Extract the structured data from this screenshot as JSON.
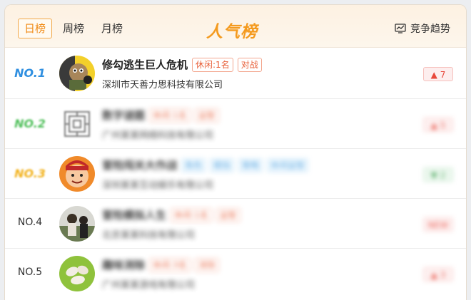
{
  "header": {
    "tabs": [
      {
        "label": "日榜",
        "active": true
      },
      {
        "label": "周榜",
        "active": false
      },
      {
        "label": "月榜",
        "active": false
      }
    ],
    "title": "人气榜",
    "trend_label": "竞争趋势",
    "trend_icon": "chart-trend-icon"
  },
  "colors": {
    "accent": "#f49a1e",
    "rank1": "#2f8fe0",
    "rank2": "#4fbf5a",
    "rank3": "#f2b21c",
    "up": "#e8483b",
    "down": "#3da150"
  },
  "rows": [
    {
      "rank": "NO.1",
      "name": "修勾逃生巨人危机",
      "tags": [
        "休闲:1名",
        "对战"
      ],
      "company": "深圳市天善力思科技有限公司",
      "change": "▲ 7",
      "direction": "up"
    },
    {
      "rank": "NO.2",
      "name": "数字谜题",
      "tags": [
        "休闲:1名",
        "益智"
      ],
      "company": "广州某某网络科技有限公司",
      "change": "▲ 5",
      "direction": "up"
    },
    {
      "rank": "NO.3",
      "name": "冒险闯关大作战",
      "tags": [
        "角色",
        "模拟",
        "策略",
        "休闲益智"
      ],
      "company": "深圳某某互动娱乐有限公司",
      "change": "▼ 2",
      "direction": "down"
    },
    {
      "rank": "NO.4",
      "name": "冒险模拟人生",
      "tags": [
        "休闲:1名",
        "益智"
      ],
      "company": "北京某某科技有限公司",
      "change": "NEW",
      "direction": "up"
    },
    {
      "rank": "NO.5",
      "name": "趣味消除",
      "tags": [
        "休闲:3名",
        "消除"
      ],
      "company": "广州某某游戏有限公司",
      "change": "▲ 3",
      "direction": "up"
    }
  ]
}
